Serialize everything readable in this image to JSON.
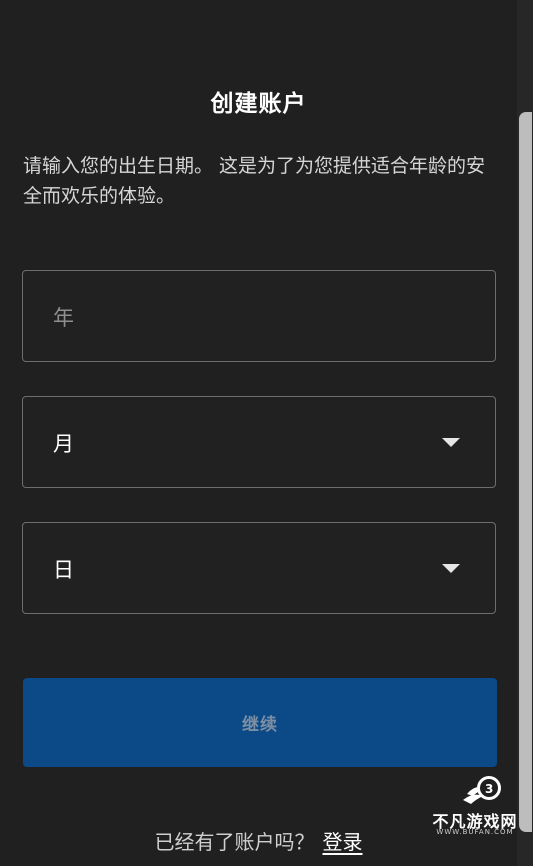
{
  "header": {
    "title": "创建账户"
  },
  "intro": {
    "text": "请输入您的出生日期。 这是为了为您提供适合年龄的安全而欢乐的体验。"
  },
  "form": {
    "year": {
      "placeholder": "年"
    },
    "month": {
      "value": "月",
      "icon": "caret-down-icon"
    },
    "day": {
      "value": "日",
      "icon": "caret-down-icon"
    },
    "continue_label": "继续"
  },
  "footer": {
    "prompt": "已经有了账户吗？",
    "login_label": "登录"
  },
  "watermark": {
    "name": "不凡游戏网",
    "url": "WWW.BUFAN.COM"
  },
  "colors": {
    "background": "#202020",
    "button": "#0b4a87",
    "border": "#6d6d6d"
  }
}
